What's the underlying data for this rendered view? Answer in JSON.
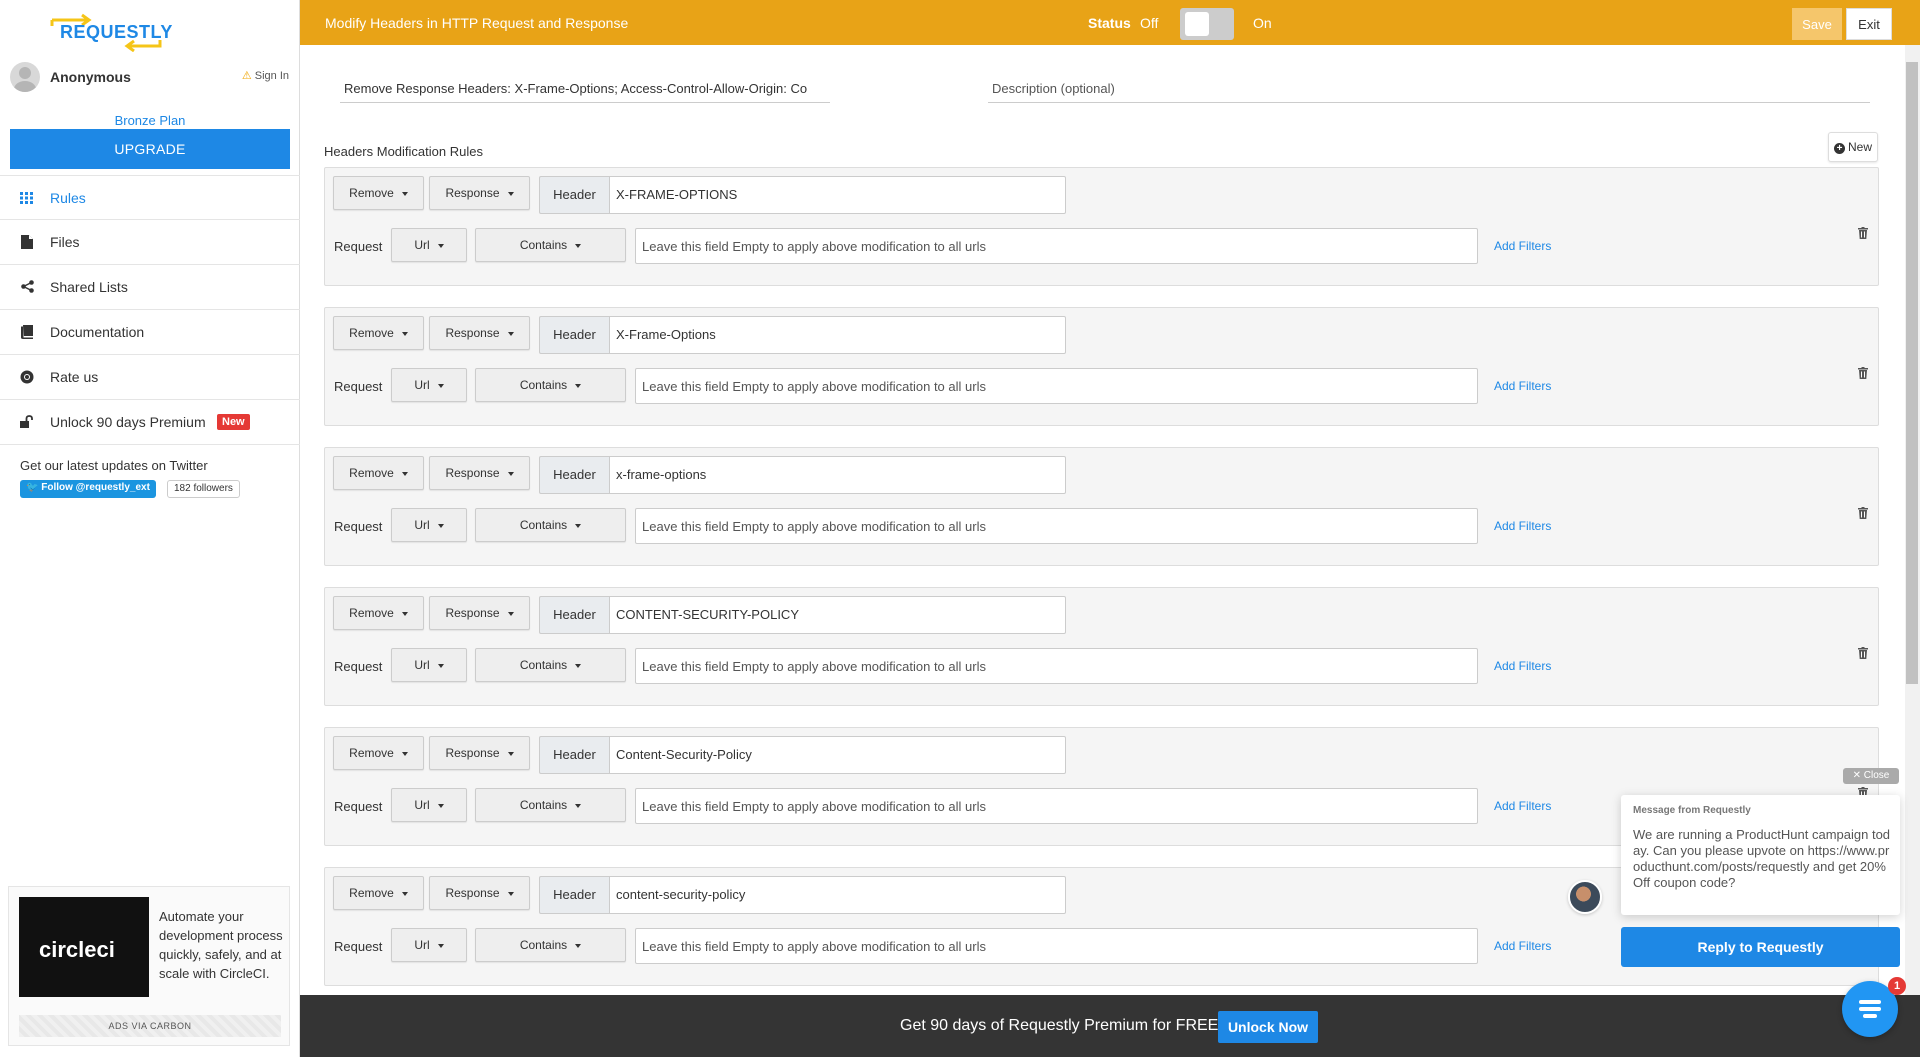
{
  "brand": {
    "logo_text": "REQUESTLY"
  },
  "user": {
    "name": "Anonymous",
    "signin_label": "Sign In"
  },
  "plan": {
    "name": "Bronze Plan",
    "upgrade_label": "UPGRADE"
  },
  "sidebar": {
    "items": [
      {
        "label": "Rules",
        "icon": "grid-icon",
        "active": true
      },
      {
        "label": "Files",
        "icon": "file-icon"
      },
      {
        "label": "Shared Lists",
        "icon": "share-icon"
      },
      {
        "label": "Documentation",
        "icon": "book-icon"
      },
      {
        "label": "Rate us",
        "icon": "chrome-icon"
      },
      {
        "label": "Unlock 90 days Premium",
        "icon": "unlock-icon",
        "badge": "New"
      }
    ],
    "twitter_text": "Get our latest updates on Twitter",
    "twitter_follow": "Follow @requestly_ext",
    "twitter_followers": "182 followers"
  },
  "ad": {
    "image_text": "circleci",
    "text": "Automate your development process quickly, safely, and at scale with CircleCI.",
    "footer": "ADS VIA CARBON"
  },
  "topbar": {
    "title": "Modify Headers in HTTP Request and Response",
    "status_label": "Status",
    "off_label": "Off",
    "on_label": "On",
    "save_label": "Save",
    "exit_label": "Exit",
    "accent_color": "#e8a317"
  },
  "form": {
    "rule_name": "Remove Response Headers: X-Frame-Options; Access-Control-Allow-Origin: Co",
    "description_placeholder": "Description (optional)",
    "section_title": "Headers Modification Rules",
    "new_label": "New"
  },
  "rules": [
    {
      "action": "Remove",
      "target": "Response",
      "header_label": "Header",
      "header_value": "X-FRAME-OPTIONS",
      "request_label": "Request",
      "source_key": "Url",
      "operator": "Contains",
      "url_placeholder": "Leave this field Empty to apply above modification to all urls",
      "filters_label": "Add Filters"
    },
    {
      "action": "Remove",
      "target": "Response",
      "header_label": "Header",
      "header_value": "X-Frame-Options",
      "request_label": "Request",
      "source_key": "Url",
      "operator": "Contains",
      "url_placeholder": "Leave this field Empty to apply above modification to all urls",
      "filters_label": "Add Filters"
    },
    {
      "action": "Remove",
      "target": "Response",
      "header_label": "Header",
      "header_value": "x-frame-options",
      "request_label": "Request",
      "source_key": "Url",
      "operator": "Contains",
      "url_placeholder": "Leave this field Empty to apply above modification to all urls",
      "filters_label": "Add Filters"
    },
    {
      "action": "Remove",
      "target": "Response",
      "header_label": "Header",
      "header_value": "CONTENT-SECURITY-POLICY",
      "request_label": "Request",
      "source_key": "Url",
      "operator": "Contains",
      "url_placeholder": "Leave this field Empty to apply above modification to all urls",
      "filters_label": "Add Filters"
    },
    {
      "action": "Remove",
      "target": "Response",
      "header_label": "Header",
      "header_value": "Content-Security-Policy",
      "request_label": "Request",
      "source_key": "Url",
      "operator": "Contains",
      "url_placeholder": "Leave this field Empty to apply above modification to all urls",
      "filters_label": "Add Filters"
    },
    {
      "action": "Remove",
      "target": "Response",
      "header_label": "Header",
      "header_value": "content-security-policy",
      "request_label": "Request",
      "source_key": "Url",
      "operator": "Contains",
      "url_placeholder": "Leave this field Empty to apply above modification to all urls",
      "filters_label": "Add Filters"
    }
  ],
  "promo": {
    "text": "Get 90 days of Requestly Premium for FREE",
    "button_label": "Unlock Now"
  },
  "chat": {
    "close_label": "Close",
    "from": "Message from Requestly",
    "message": "We are running a ProductHunt campaign today. Can you please upvote on https://www.producthunt.com/posts/requestly and get 20% Off coupon code?",
    "reply_label": "Reply to Requestly",
    "badge_count": "1"
  }
}
